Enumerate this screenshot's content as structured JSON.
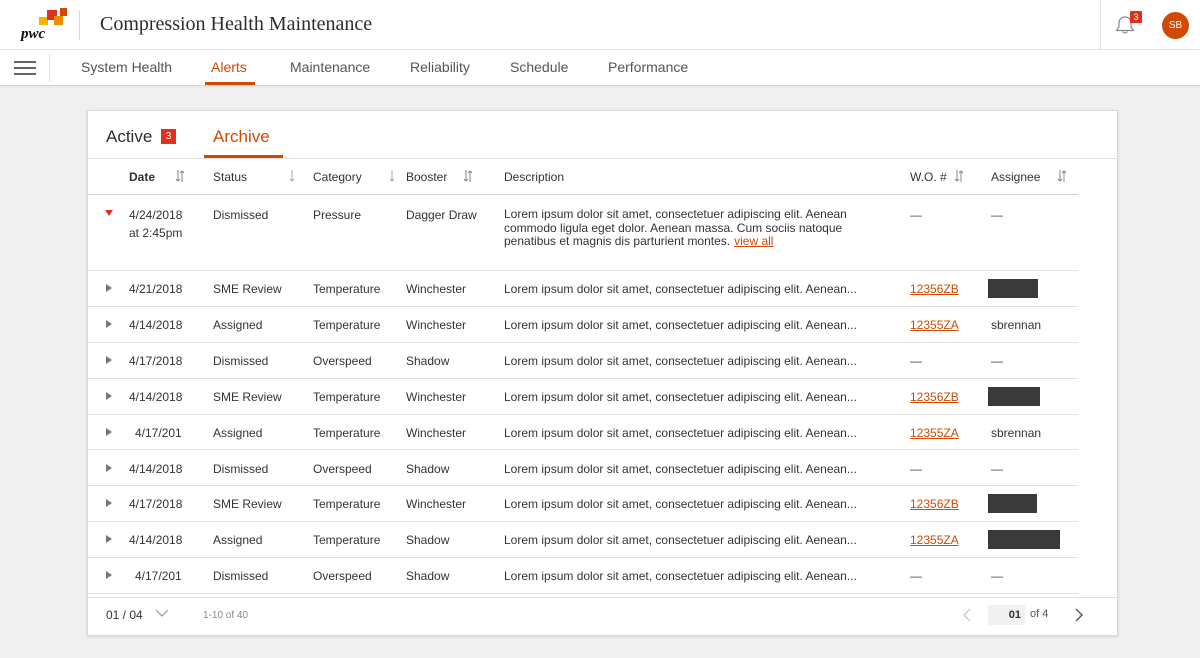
{
  "header": {
    "logo_text": "pwc",
    "title": "Compression Health Maintenance",
    "notification_count": "3",
    "user_initials": "SB"
  },
  "nav": {
    "items": [
      "System Health",
      "Alerts",
      "Maintenance",
      "Reliability",
      "Schedule",
      "Performance"
    ],
    "active": "Alerts"
  },
  "tabs": {
    "active_label": "Active",
    "active_count": "3",
    "archive_label": "Archive"
  },
  "table": {
    "columns": {
      "date": "Date",
      "status": "Status",
      "category": "Category",
      "booster": "Booster",
      "description": "Description",
      "wo": "W.O. #",
      "assignee": "Assignee"
    },
    "expanded_row": {
      "date": "4/24/2018",
      "time": "at 2:45pm",
      "status": "Dismissed",
      "category": "Pressure",
      "booster": "Dagger Draw",
      "description": "Lorem ipsum dolor sit amet, consectetuer adipiscing elit. Aenean commodo ligula eget dolor. Aenean massa. Cum sociis natoque penatibus et magnis dis parturient montes.",
      "view_all": "view all",
      "wo": "—",
      "assignee": "—"
    },
    "rows": [
      {
        "date": "4/21/2018",
        "status": "SME Review",
        "category": "Temperature",
        "booster": "Winchester",
        "description": "Lorem ipsum dolor sit amet, consectetuer adipiscing elit. Aenean...",
        "wo": "12356ZB",
        "assignee": ""
      },
      {
        "date": "4/14/2018",
        "status": "Assigned",
        "category": "Temperature",
        "booster": "Winchester",
        "description": "Lorem ipsum dolor sit amet, consectetuer adipiscing elit. Aenean...",
        "wo": "12355ZA",
        "assignee": "sbrennan"
      },
      {
        "date": "4/17/2018",
        "status": "Dismissed",
        "category": "Overspeed",
        "booster": "Shadow",
        "description": "Lorem ipsum dolor sit amet, consectetuer adipiscing elit. Aenean...",
        "wo": "—",
        "assignee": "—"
      },
      {
        "date": "4/14/2018",
        "status": "SME Review",
        "category": "Temperature",
        "booster": "Winchester",
        "description": "Lorem ipsum dolor sit amet, consectetuer adipiscing elit. Aenean...",
        "wo": "12356ZB",
        "assignee": ""
      },
      {
        "date": "4/17/201",
        "status": "Assigned",
        "category": "Temperature",
        "booster": "Winchester",
        "description": "Lorem ipsum dolor sit amet, consectetuer adipiscing elit. Aenean...",
        "wo": "12355ZA",
        "assignee": "sbrennan"
      },
      {
        "date": "4/14/2018",
        "status": "Dismissed",
        "category": "Overspeed",
        "booster": "Shadow",
        "description": "Lorem ipsum dolor sit amet, consectetuer adipiscing elit. Aenean...",
        "wo": "—",
        "assignee": "—"
      },
      {
        "date": "4/17/2018",
        "status": "SME Review",
        "category": "Temperature",
        "booster": "Winchester",
        "description": "Lorem ipsum dolor sit amet, consectetuer adipiscing elit. Aenean...",
        "wo": "12356ZB",
        "assignee": ""
      },
      {
        "date": "4/14/2018",
        "status": "Assigned",
        "category": "Temperature",
        "booster": "Shadow",
        "description": "Lorem ipsum dolor sit amet, consectetuer adipiscing elit. Aenean...",
        "wo": "12355ZA",
        "assignee": ""
      },
      {
        "date": "4/17/201",
        "status": "Dismissed",
        "category": "Overspeed",
        "booster": "Shadow",
        "description": "Lorem ipsum dolor sit amet, consectetuer adipiscing elit. Aenean...",
        "wo": "—",
        "assignee": "—"
      }
    ]
  },
  "pagination": {
    "page_display": "01 / 04",
    "range": "1-10 of 40",
    "current_page": "01",
    "total_label": "of 4"
  },
  "colors": {
    "accent": "#d04a02",
    "badge": "#e0301e",
    "redacted": "#3a3a3a"
  }
}
